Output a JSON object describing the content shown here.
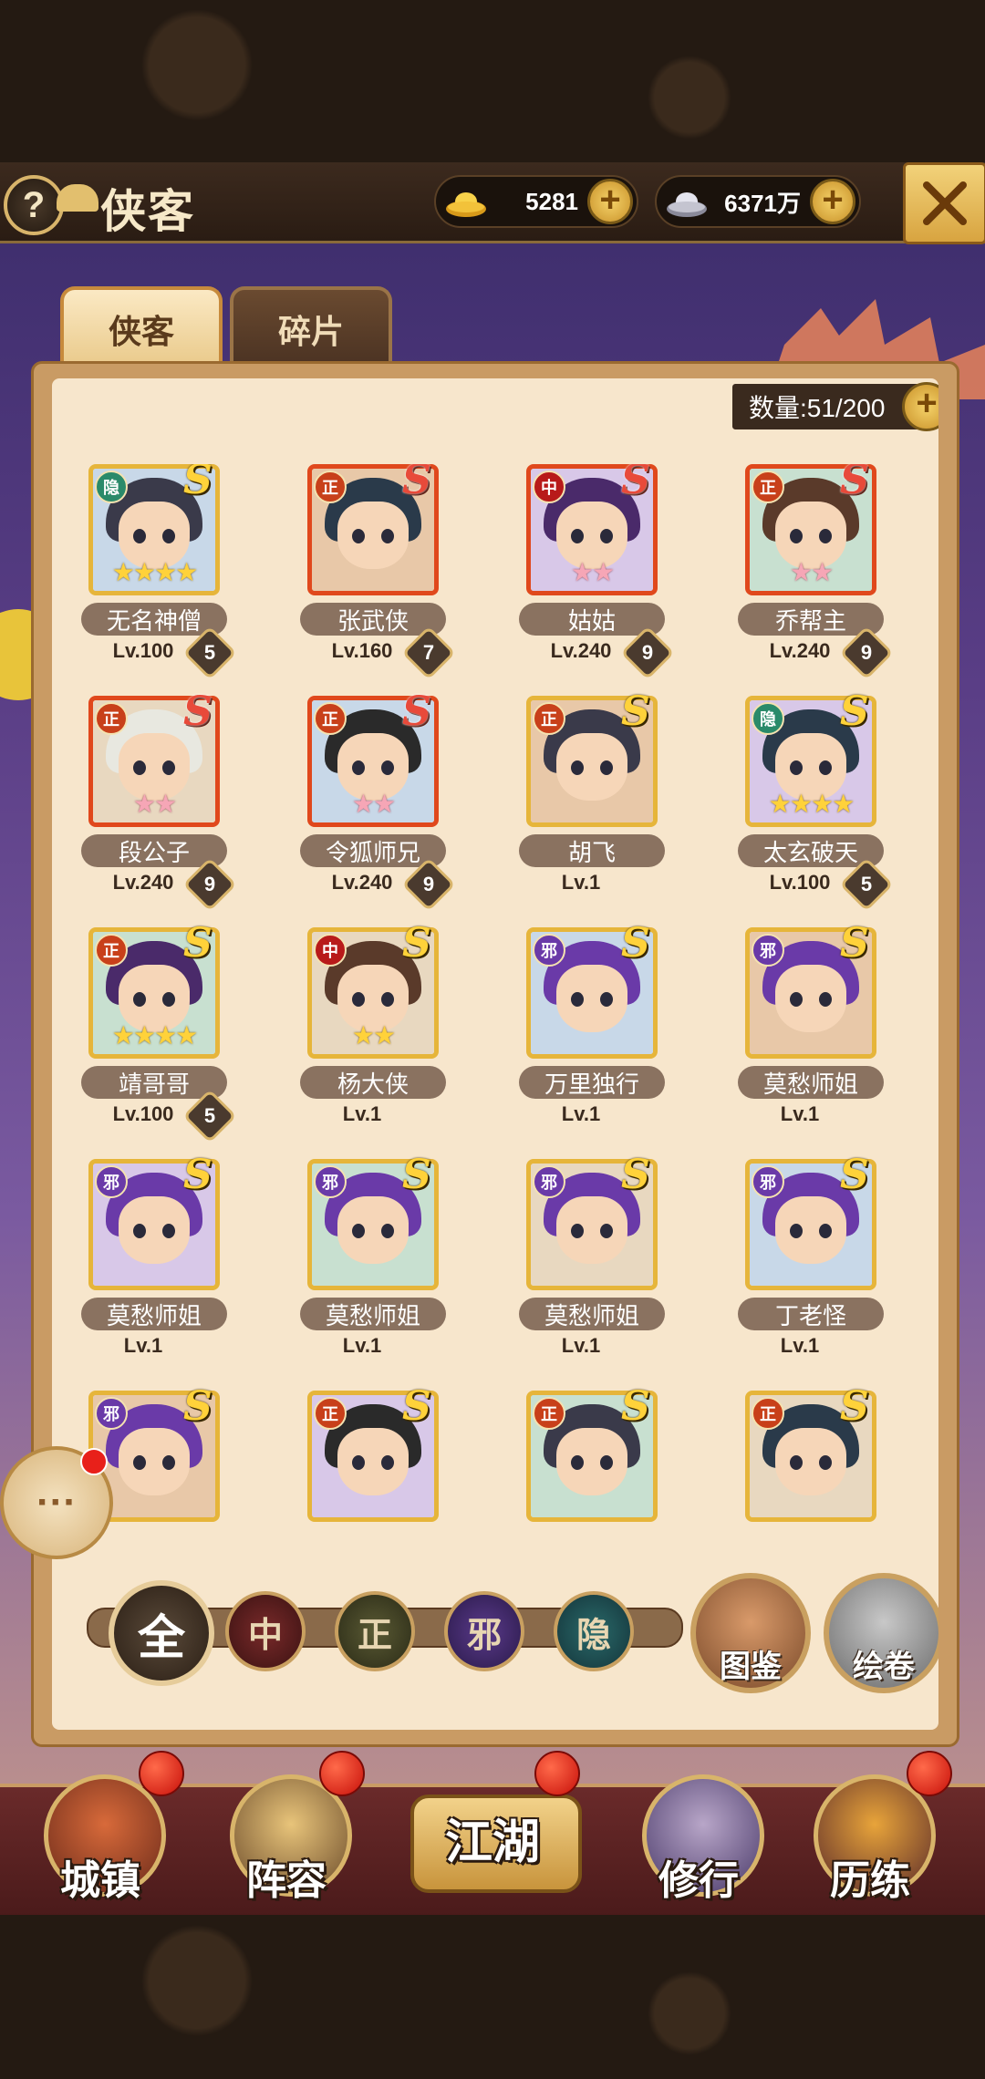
{
  "header": {
    "title": "侠客",
    "help_label": "?",
    "gold": "5281",
    "silver": "6371万",
    "plus": "+"
  },
  "tabs": [
    {
      "label": "侠客",
      "active": true
    },
    {
      "label": "碎片",
      "active": false
    }
  ],
  "count_label": "数量:51/200",
  "heroes": [
    {
      "name": "无名神僧",
      "level": "Lv.100",
      "bond": "5",
      "faction": "隐",
      "rank": "S",
      "rank_color": "gold",
      "frame": "gold",
      "stars": "★★★★",
      "star_color": "gold"
    },
    {
      "name": "张武侠",
      "level": "Lv.160",
      "bond": "7",
      "faction": "正",
      "rank": "S",
      "rank_color": "red",
      "frame": "red",
      "stars": "",
      "star_color": "gold"
    },
    {
      "name": "姑姑",
      "level": "Lv.240",
      "bond": "9",
      "faction": "中",
      "rank": "S",
      "rank_color": "red",
      "frame": "red",
      "stars": "★★",
      "star_color": "pink"
    },
    {
      "name": "乔帮主",
      "level": "Lv.240",
      "bond": "9",
      "faction": "正",
      "rank": "S",
      "rank_color": "red",
      "frame": "red",
      "stars": "★★",
      "star_color": "pink"
    },
    {
      "name": "段公子",
      "level": "Lv.240",
      "bond": "9",
      "faction": "正",
      "rank": "S",
      "rank_color": "red",
      "frame": "red",
      "stars": "★★",
      "star_color": "pink"
    },
    {
      "name": "令狐师兄",
      "level": "Lv.240",
      "bond": "9",
      "faction": "正",
      "rank": "S",
      "rank_color": "red",
      "frame": "red",
      "stars": "★★",
      "star_color": "pink"
    },
    {
      "name": "胡飞",
      "level": "Lv.1",
      "bond": "",
      "faction": "正",
      "rank": "S",
      "rank_color": "gold",
      "frame": "gold",
      "stars": "",
      "star_color": "gold"
    },
    {
      "name": "太玄破天",
      "level": "Lv.100",
      "bond": "5",
      "faction": "隐",
      "rank": "S",
      "rank_color": "gold",
      "frame": "gold",
      "stars": "★★★★",
      "star_color": "gold"
    },
    {
      "name": "靖哥哥",
      "level": "Lv.100",
      "bond": "5",
      "faction": "正",
      "rank": "S",
      "rank_color": "gold",
      "frame": "gold",
      "stars": "★★★★",
      "star_color": "gold"
    },
    {
      "name": "杨大侠",
      "level": "Lv.1",
      "bond": "",
      "faction": "中",
      "rank": "S",
      "rank_color": "gold",
      "frame": "gold",
      "stars": "★★",
      "star_color": "gold"
    },
    {
      "name": "万里独行",
      "level": "Lv.1",
      "bond": "",
      "faction": "邪",
      "rank": "S",
      "rank_color": "gold",
      "frame": "gold",
      "stars": "",
      "star_color": "gold"
    },
    {
      "name": "莫愁师姐",
      "level": "Lv.1",
      "bond": "",
      "faction": "邪",
      "rank": "S",
      "rank_color": "gold",
      "frame": "gold",
      "stars": "",
      "star_color": "gold"
    },
    {
      "name": "莫愁师姐",
      "level": "Lv.1",
      "bond": "",
      "faction": "邪",
      "rank": "S",
      "rank_color": "gold",
      "frame": "gold",
      "stars": "",
      "star_color": "gold"
    },
    {
      "name": "莫愁师姐",
      "level": "Lv.1",
      "bond": "",
      "faction": "邪",
      "rank": "S",
      "rank_color": "gold",
      "frame": "gold",
      "stars": "",
      "star_color": "gold"
    },
    {
      "name": "莫愁师姐",
      "level": "Lv.1",
      "bond": "",
      "faction": "邪",
      "rank": "S",
      "rank_color": "gold",
      "frame": "gold",
      "stars": "",
      "star_color": "gold"
    },
    {
      "name": "丁老怪",
      "level": "Lv.1",
      "bond": "",
      "faction": "邪",
      "rank": "S",
      "rank_color": "gold",
      "frame": "gold",
      "stars": "",
      "star_color": "gold"
    },
    {
      "name": "",
      "level": "",
      "bond": "",
      "faction": "邪",
      "rank": "S",
      "rank_color": "gold",
      "frame": "gold",
      "stars": "",
      "star_color": "gold"
    },
    {
      "name": "",
      "level": "",
      "bond": "",
      "faction": "正",
      "rank": "S",
      "rank_color": "gold",
      "frame": "gold",
      "stars": "",
      "star_color": "gold"
    },
    {
      "name": "",
      "level": "",
      "bond": "",
      "faction": "正",
      "rank": "S",
      "rank_color": "gold",
      "frame": "gold",
      "stars": "",
      "star_color": "gold"
    },
    {
      "name": "",
      "level": "",
      "bond": "",
      "faction": "正",
      "rank": "S",
      "rank_color": "gold",
      "frame": "gold",
      "stars": "",
      "star_color": "gold"
    }
  ],
  "filters": {
    "all": "全",
    "zhong": "中",
    "zheng": "正",
    "xie": "邪",
    "yin": "隐"
  },
  "round_buttons": {
    "tujian": "图鉴",
    "huijuan": "绘卷"
  },
  "chat_icon": "chat-bubble-icon",
  "nav": {
    "town": "城镇",
    "lineup": "阵容",
    "jianghu": "江湖",
    "cultivate": "修行",
    "trial": "历练"
  },
  "colors": {
    "faction_yin": "#2a8a6a",
    "faction_zheng": "#c8401a",
    "faction_zhong": "#b81a1a",
    "faction_xie": "#6a3aa8"
  }
}
